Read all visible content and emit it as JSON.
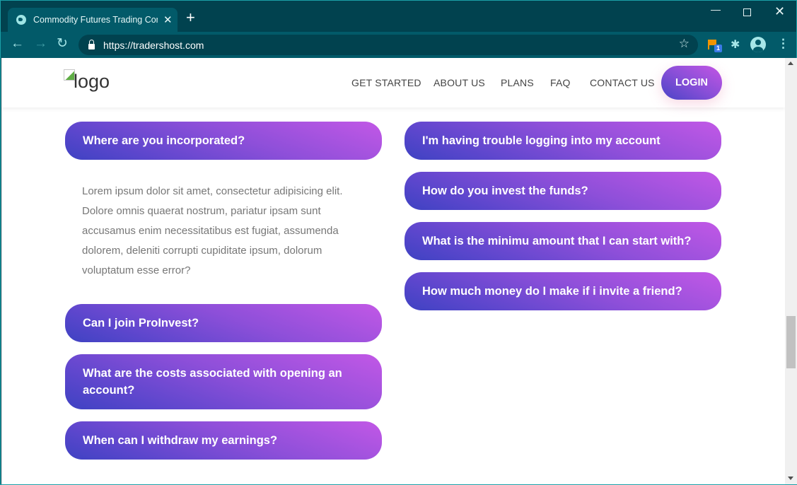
{
  "browser": {
    "tab_title": "Commodity Futures Trading Com",
    "tab_close": "✕",
    "new_tab": "+",
    "url": "https://tradershost.com",
    "extension_badge": "1",
    "window_controls": {
      "minimize": "—",
      "close": "✕"
    },
    "icons": {
      "back": "←",
      "forward": "→",
      "reload": "↻",
      "star": "☆",
      "puzzle": "✱",
      "menu": "⋮"
    }
  },
  "header": {
    "logo_alt": "logo",
    "nav": [
      "GET STARTED",
      "ABOUT US",
      "PLANS",
      "FAQ",
      "CONTACT US"
    ],
    "login_label": "LOGIN"
  },
  "faq": {
    "left": [
      {
        "question": "Where are you incorporated?",
        "expanded": true,
        "answer": "Lorem ipsum dolor sit amet, consectetur adipisicing elit. Dolore omnis quaerat nostrum, pariatur ipsam sunt accusamus enim necessitatibus est fugiat, assumenda dolorem, deleniti corrupti cupiditate ipsum, dolorum voluptatum esse error?"
      },
      {
        "question": "Can I join ProInvest?"
      },
      {
        "question": "What are the costs associated with opening an account?"
      },
      {
        "question": "When can I withdraw my earnings?"
      }
    ],
    "right": [
      {
        "question": "I'm having trouble logging into my account"
      },
      {
        "question": "How do you invest the funds?"
      },
      {
        "question": "What is the minimu amount that I can start with?"
      },
      {
        "question": "How much money do I make if i invite a friend?"
      }
    ]
  },
  "colors": {
    "browser_frame": "#01424f",
    "toolbar": "#025a69",
    "accent_gradient_start": "#c258e6",
    "accent_gradient_end": "#3e42c2",
    "answer_text": "#777777"
  }
}
